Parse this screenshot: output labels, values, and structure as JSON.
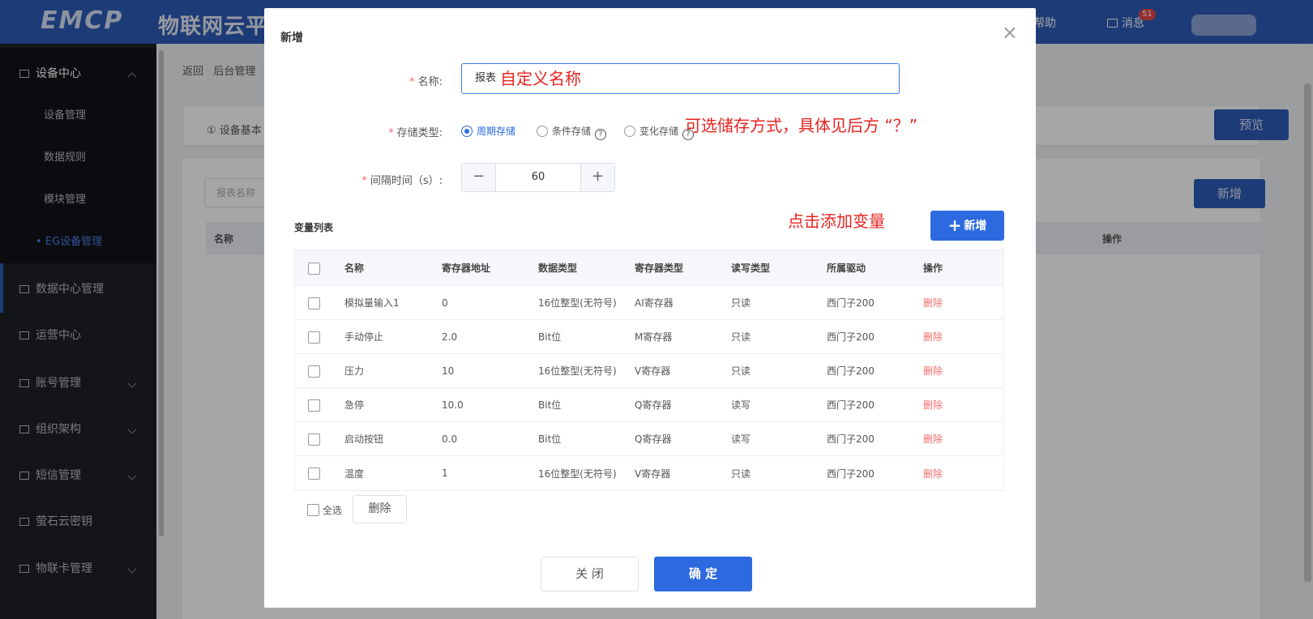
{
  "header": {
    "logo": "EMCP",
    "platform_name": "物联网云平",
    "help": "帮助",
    "messages": "消息",
    "message_count": "51"
  },
  "sidebar": {
    "groups": [
      {
        "label": "设备中心",
        "children": [
          "设备管理",
          "数据规则",
          "模块管理",
          "EG设备管理"
        ]
      },
      {
        "label": "数据中心管理"
      },
      {
        "label": "运营中心"
      },
      {
        "label": "账号管理"
      },
      {
        "label": "组织架构"
      },
      {
        "label": "短信管理"
      },
      {
        "label": "萤石云密钥"
      },
      {
        "label": "物联卡管理"
      }
    ],
    "active_child": "• EG设备管理"
  },
  "background": {
    "back": "返回",
    "breadcrumb": "后台管理",
    "card_label": "① 设备基本",
    "preview": "预览",
    "search_placeholder": "报表名称",
    "new": "新增",
    "col_name": "名称",
    "col_op": "操作"
  },
  "modal": {
    "title": "新增",
    "close_icon": "×",
    "name_label": "名称:",
    "name_value": "报表",
    "name_note": "自定义名称",
    "storage_label": "存储类型:",
    "storage_options": [
      "周期存储",
      "条件存储",
      "变化存储"
    ],
    "storage_selected": "周期存储",
    "storage_note": "可选储存方式，具体见后方 “？”",
    "interval_label": "间隔时间（s）:",
    "interval_value": "60",
    "var_list_title": "变量列表",
    "add_var_note": "点击添加变量",
    "add_var_button": "新增",
    "columns": [
      "名称",
      "寄存器地址",
      "数据类型",
      "寄存器类型",
      "读写类型",
      "所属驱动",
      "操作"
    ],
    "rows": [
      [
        "模拟量输入1",
        "0",
        "16位整型(无符号)",
        "AI寄存器",
        "只读",
        "西门子200",
        "删除"
      ],
      [
        "手动停止",
        "2.0",
        "Bit位",
        "M寄存器",
        "只读",
        "西门子200",
        "删除"
      ],
      [
        "压力",
        "10",
        "16位整型(无符号)",
        "V寄存器",
        "只读",
        "西门子200",
        "删除"
      ],
      [
        "急停",
        "10.0",
        "Bit位",
        "Q寄存器",
        "读写",
        "西门子200",
        "删除"
      ],
      [
        "启动按钮",
        "0.0",
        "Bit位",
        "Q寄存器",
        "读写",
        "西门子200",
        "删除"
      ],
      [
        "温度",
        "1",
        "16位整型(无符号)",
        "V寄存器",
        "只读",
        "西门子200",
        "删除"
      ]
    ],
    "select_all": "全选",
    "delete_button": "删除",
    "close_button": "关 闭",
    "confirm_button": "确 定"
  },
  "colors": {
    "primary": "#2d6ae0",
    "header": "#2d5bb5",
    "danger": "#f56c6c",
    "annotation": "#e8231f"
  }
}
